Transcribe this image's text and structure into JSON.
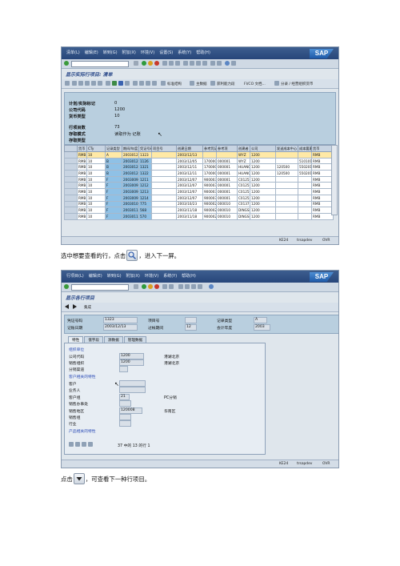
{
  "shot1": {
    "menu": [
      "清单(L)",
      "编辑(E)",
      "转到(G)",
      "附加(X)",
      "环境(V)",
      "设置(S)",
      "系统(Y)",
      "帮助(H)"
    ],
    "logo": "SAP",
    "title": "显示实际行项目: 清单",
    "toolbar_items": [
      "标准结构",
      "主数据",
      "获利能力段",
      "FI/CO 文档...",
      "分录 / 经营组织货币"
    ],
    "header": [
      {
        "label": "计划/实际标记",
        "value": "0"
      },
      {
        "label": "公司代码",
        "value": "1200"
      },
      {
        "label": "货币类型",
        "value": "10"
      },
      {
        "label": "行项目数",
        "value": "73"
      },
      {
        "label": "存取模式",
        "value": "读取作为 记账"
      },
      {
        "label": "存取类型",
        "value": ""
      }
    ],
    "columns": [
      "货币",
      "CTy",
      "记录类型",
      "期间/年度",
      "凭证号码",
      "项目号",
      "创建日期",
      "参考凭证号",
      "参考项",
      "创建者",
      "公司",
      "发送成本中心",
      "成本要素",
      "货币"
    ],
    "rows": [
      [
        "RMB",
        "10",
        "A",
        "2003012",
        "1323",
        "",
        "2003/12/13",
        "",
        "",
        "WYZ",
        "1200",
        "",
        "",
        "RMB"
      ],
      [
        "RMB",
        "10",
        "B",
        "2003012",
        "1126",
        "",
        "2003/12/05",
        "1700000008",
        "000001",
        "WYZ",
        "1200",
        "",
        "51010101",
        "RMB"
      ],
      [
        "RMB",
        "10",
        "B",
        "2003012",
        "1321",
        "",
        "2003/12/11",
        "1700000024",
        "000001",
        "HUANGPH",
        "1200",
        "120500",
        "55020101",
        "RMB"
      ],
      [
        "RMB",
        "10",
        "B",
        "2003012",
        "1322",
        "",
        "2003/12/11",
        "1700000048",
        "000001",
        "HUANGPH",
        "1200",
        "120500",
        "55020101",
        "RMB"
      ],
      [
        "RMB",
        "10",
        "F",
        "2003009",
        "1211",
        "",
        "2003/12/07",
        "90000351",
        "000001",
        "C0125",
        "1200",
        "",
        "",
        "RMB"
      ],
      [
        "RMB",
        "10",
        "F",
        "2003009",
        "1212",
        "",
        "2003/12/07",
        "90000352",
        "000001",
        "C0125",
        "1200",
        "",
        "",
        "RMB"
      ],
      [
        "RMB",
        "10",
        "F",
        "2003009",
        "1213",
        "",
        "2003/12/07",
        "90000353",
        "000001",
        "C0125",
        "1200",
        "",
        "",
        "RMB"
      ],
      [
        "RMB",
        "10",
        "F",
        "2003009",
        "1214",
        "",
        "2003/12/07",
        "90000354",
        "000001",
        "C0125",
        "1200",
        "",
        "",
        "RMB"
      ],
      [
        "RMB",
        "10",
        "F",
        "2003010",
        "775",
        "",
        "2003/10/23",
        "90000274",
        "000010",
        "C0137",
        "1200",
        "",
        "",
        "RMB"
      ],
      [
        "RMB",
        "10",
        "F",
        "2003011",
        "568",
        "",
        "2003/11/18",
        "90000240",
        "000010",
        "DINGSHG",
        "1200",
        "",
        "",
        "RMB"
      ],
      [
        "RMB",
        "10",
        "F",
        "2003011",
        "570",
        "",
        "2003/11/18",
        "90000242",
        "000010",
        "DINGSHG",
        "1200",
        "",
        "",
        "RMB"
      ]
    ],
    "status": [
      "KE24",
      "trsapdev",
      "OVR"
    ]
  },
  "caption1": {
    "before": "选中想要查看的行，点击",
    "after": "，进入下一屏。"
  },
  "shot2": {
    "menu": [
      "行项目(L)",
      "编辑(E)",
      "转到(G)",
      "附加(X)",
      "环境(V)",
      "系统(Y)",
      "帮助(H)"
    ],
    "logo": "SAP",
    "title": "显示各行项目",
    "toolbar_item": "集成",
    "top": [
      {
        "label": "凭证号码",
        "value": "1323"
      },
      {
        "label": "项目号",
        "value": ""
      },
      {
        "label": "记录类型",
        "value": "A"
      },
      {
        "label": "记账日期",
        "value": "2003/12/13"
      },
      {
        "label": "过帐期间",
        "value": "12"
      },
      {
        "label": "会计年度",
        "value": "2003"
      }
    ],
    "tabs": [
      "特性",
      "值字段",
      "源数据",
      "管理数据"
    ],
    "sections": [
      "组织单位",
      "客户相关的特性",
      "产品相关的特性"
    ],
    "fields": [
      {
        "label": "公司代码",
        "value": "1200",
        "desc": "港湖北京"
      },
      {
        "label": "销售组织",
        "value": "1200",
        "desc": "港湖北京"
      },
      {
        "label": "分销渠道",
        "value": "",
        "desc": ""
      },
      {
        "label": "客户",
        "value": "",
        "desc": ""
      },
      {
        "label": "业务人",
        "value": "",
        "desc": ""
      },
      {
        "label": "客户组",
        "value": "21",
        "desc": "PC分销"
      },
      {
        "label": "销售办事处",
        "value": "",
        "desc": ""
      },
      {
        "label": "销售地区",
        "value": "120008",
        "desc": "华南区"
      },
      {
        "label": "销售组",
        "value": "",
        "desc": ""
      },
      {
        "label": "行业",
        "value": "",
        "desc": ""
      }
    ],
    "entry": "37 中的 13 的行 1",
    "status": [
      "KE24",
      "trsapdev",
      "OVR"
    ]
  },
  "caption2": {
    "before": "点击",
    "after": "，可查看下一种行项目。"
  },
  "colors": {
    "menubar": "#27467a",
    "panel": "#b9cfdf",
    "highlight": "#8fc1e6",
    "selected": "#ffe9a6"
  }
}
